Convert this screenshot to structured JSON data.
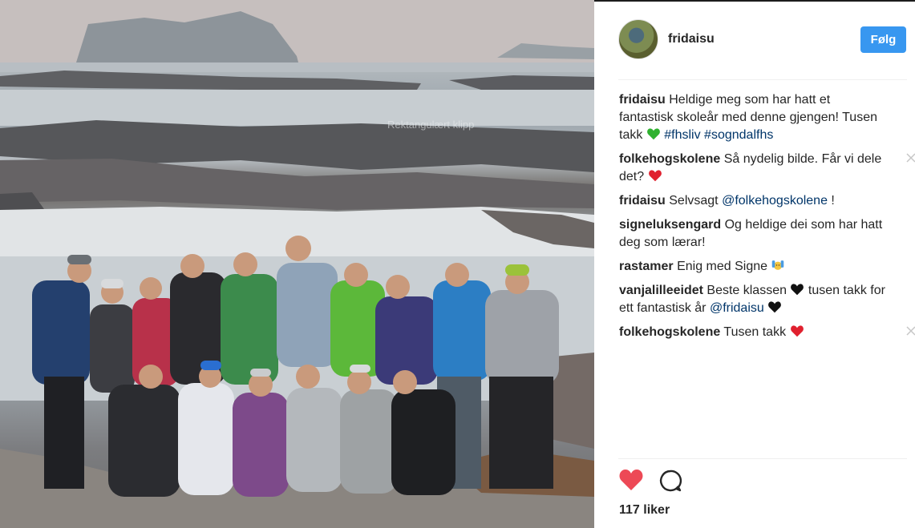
{
  "photo": {
    "alt_overlay_text": "Rektangulært klipp"
  },
  "header": {
    "username": "fridaisu",
    "follow_label": "Følg"
  },
  "comments": [
    {
      "user": "fridaisu",
      "text": "Heldige meg som har hatt et fantastisk skoleår med denne gjengen! Tusen takk",
      "emoji": "green-heart",
      "tags": "#fhsliv #sogndalfhs",
      "removable": false
    },
    {
      "user": "folkehogskolene",
      "text": "Så nydelig bilde. Får vi dele det?",
      "emoji": "red-heart",
      "removable": true
    },
    {
      "user": "fridaisu",
      "text": "Selvsagt",
      "mention": "@folkehogskolene",
      "after": " !",
      "removable": false
    },
    {
      "user": "signeluksengard",
      "text": "Og heldige dei som har hatt deg som lærar!",
      "removable": false
    },
    {
      "user": "rastamer",
      "text": "Enig med Signe",
      "emoji": "raising-hands",
      "removable": false
    },
    {
      "user": "vanjalilleeidet",
      "text": "Beste klassen",
      "emoji": "black-heart",
      "text2": " tusen takk for ett fantastisk år",
      "mention": "@fridaisu",
      "removable": false
    },
    {
      "user": "folkehogskolene",
      "text": "Tusen takk",
      "emoji": "red-heart",
      "removable": true
    }
  ],
  "actions": {
    "like_icon": "heart-icon",
    "comment_icon": "comment-icon",
    "like_color": "#ed4956"
  },
  "likes": {
    "count_label": "117 liker"
  },
  "colors": {
    "follow_button": "#3897f0",
    "tag_link": "#003569"
  }
}
